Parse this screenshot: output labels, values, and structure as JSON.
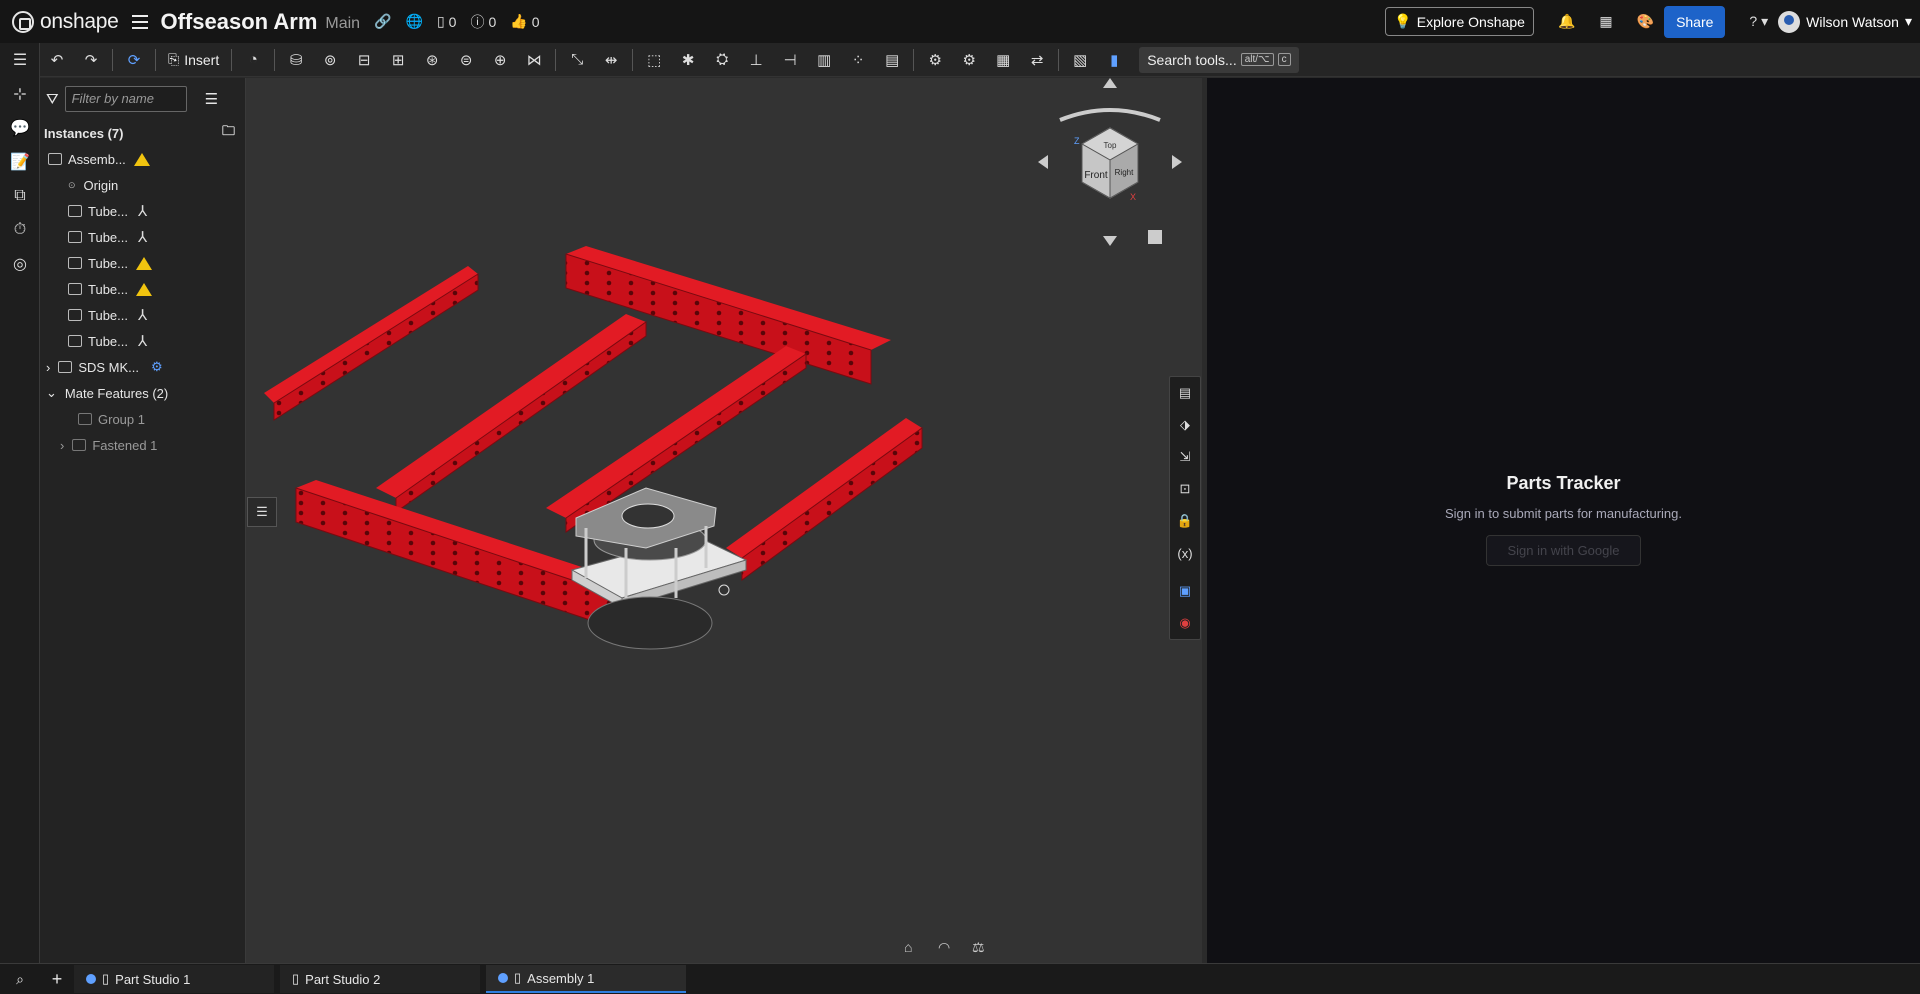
{
  "app": {
    "brand": "onshape",
    "doc_title": "Offseason Arm",
    "branch": "Main"
  },
  "topbar": {
    "counts": {
      "versions": "0",
      "issues": "0",
      "likes": "0"
    },
    "explore_label": "Explore Onshape",
    "share_label": "Share",
    "user_name": "Wilson Watson"
  },
  "toolbar": {
    "insert_label": "Insert",
    "search_label": "Search tools...",
    "search_kbd": "alt/⌥",
    "search_kbd2": "c"
  },
  "tree": {
    "filter_placeholder": "Filter by name",
    "instances_header": "Instances (7)",
    "items": [
      {
        "label": "Assemb...",
        "badge": "warning"
      },
      {
        "label": "Origin",
        "badge": ""
      },
      {
        "label": "Tube...",
        "badge": "mate"
      },
      {
        "label": "Tube...",
        "badge": "mate"
      },
      {
        "label": "Tube...",
        "badge": "warning"
      },
      {
        "label": "Tube...",
        "badge": "warning"
      },
      {
        "label": "Tube...",
        "badge": "mate"
      },
      {
        "label": "Tube...",
        "badge": "mate"
      },
      {
        "label": "SDS MK...",
        "badge": "config"
      }
    ],
    "mate_header": "Mate Features (2)",
    "mates": [
      {
        "label": "Group 1"
      },
      {
        "label": "Fastened 1"
      }
    ]
  },
  "viewcube": {
    "top": "Top",
    "front": "Front",
    "right": "Right",
    "x": "X",
    "z": "Z"
  },
  "parts_tracker": {
    "title": "Parts Tracker",
    "subtitle": "Sign in to submit parts for manufacturing.",
    "button": "Sign in with Google"
  },
  "tabs": [
    {
      "label": "Part Studio 1",
      "active": false
    },
    {
      "label": "Part Studio 2",
      "active": false
    },
    {
      "label": "Assembly 1",
      "active": true
    }
  ],
  "colors": {
    "accent": "#1d63c9",
    "tube": "#c8101a",
    "warning": "#f1c40f"
  }
}
